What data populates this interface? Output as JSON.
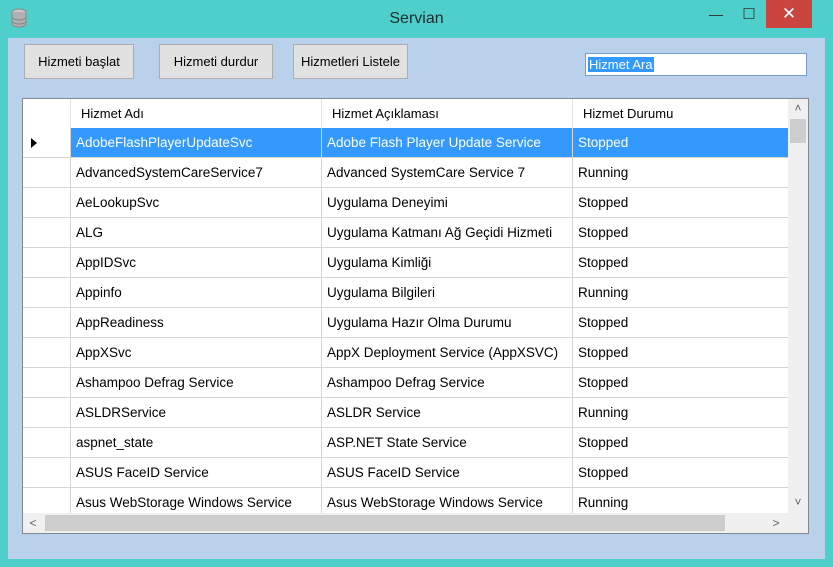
{
  "window": {
    "title": "Servian",
    "minimize_glyph": "—",
    "maximize_glyph": "☐",
    "close_glyph": "✕",
    "colors": {
      "frame": "#4fcfcb",
      "close": "#c9453d",
      "client": "#b9d1ea",
      "selection": "#3399ff"
    }
  },
  "toolbar": {
    "start_label": "Hizmeti başlat",
    "stop_label": "Hizmeti durdur",
    "list_label": "Hizmetleri Listele"
  },
  "search": {
    "value": "Hizmet Ara"
  },
  "table": {
    "columns": [
      "Hizmet Adı",
      "Hizmet Açıklaması",
      "Hizmet Durumu"
    ],
    "rows": [
      [
        "AdobeFlashPlayerUpdateSvc",
        "Adobe Flash Player Update Service",
        "Stopped"
      ],
      [
        "AdvancedSystemCareService7",
        "Advanced SystemCare Service 7",
        "Running"
      ],
      [
        "AeLookupSvc",
        "Uygulama Deneyimi",
        "Stopped"
      ],
      [
        "ALG",
        "Uygulama Katmanı Ağ Geçidi Hizmeti",
        "Stopped"
      ],
      [
        "AppIDSvc",
        "Uygulama Kimliği",
        "Stopped"
      ],
      [
        "Appinfo",
        "Uygulama Bilgileri",
        "Running"
      ],
      [
        "AppReadiness",
        "Uygulama Hazır Olma Durumu",
        "Stopped"
      ],
      [
        "AppXSvc",
        "AppX Deployment Service (AppXSVC)",
        "Stopped"
      ],
      [
        "Ashampoo Defrag Service",
        "Ashampoo Defrag Service",
        "Stopped"
      ],
      [
        "ASLDRService",
        "ASLDR Service",
        "Running"
      ],
      [
        "aspnet_state",
        "ASP.NET State Service",
        "Stopped"
      ],
      [
        "ASUS FaceID Service",
        "ASUS FaceID Service",
        "Stopped"
      ],
      [
        "Asus WebStorage Windows Service",
        "Asus WebStorage Windows Service",
        "Running"
      ]
    ],
    "selected_row": 0
  },
  "scroll": {
    "up": "˄",
    "down": "˅",
    "left": "<",
    "right": ">"
  }
}
